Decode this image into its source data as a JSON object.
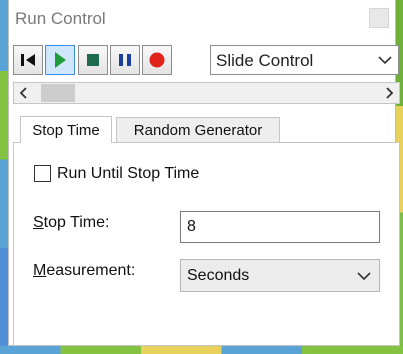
{
  "window": {
    "title": "Run Control"
  },
  "toolbar": {
    "buttons": [
      {
        "name": "step-forward",
        "icon": "skip-to-start-icon"
      },
      {
        "name": "run",
        "icon": "play-icon",
        "color": "#1e9c3a"
      },
      {
        "name": "stop",
        "icon": "stop-icon",
        "color": "#1e6b50"
      },
      {
        "name": "pause",
        "icon": "pause-icon",
        "color": "#1a3f9c"
      },
      {
        "name": "record",
        "icon": "record-icon",
        "color": "#e0231b"
      }
    ],
    "mode_select": {
      "value": "Slide Control"
    }
  },
  "tabs": [
    {
      "label": "Stop Time",
      "selected": true
    },
    {
      "label": "Random Generator",
      "selected": false
    }
  ],
  "stop_time_tab": {
    "run_until_label": "Run Until Stop Time",
    "run_until_checked": false,
    "stop_time_label_access": "S",
    "stop_time_label_rest": "top Time:",
    "stop_time_value": "8",
    "measurement_label_access": "M",
    "measurement_label_rest": "easurement:",
    "measurement_value": "Seconds"
  }
}
